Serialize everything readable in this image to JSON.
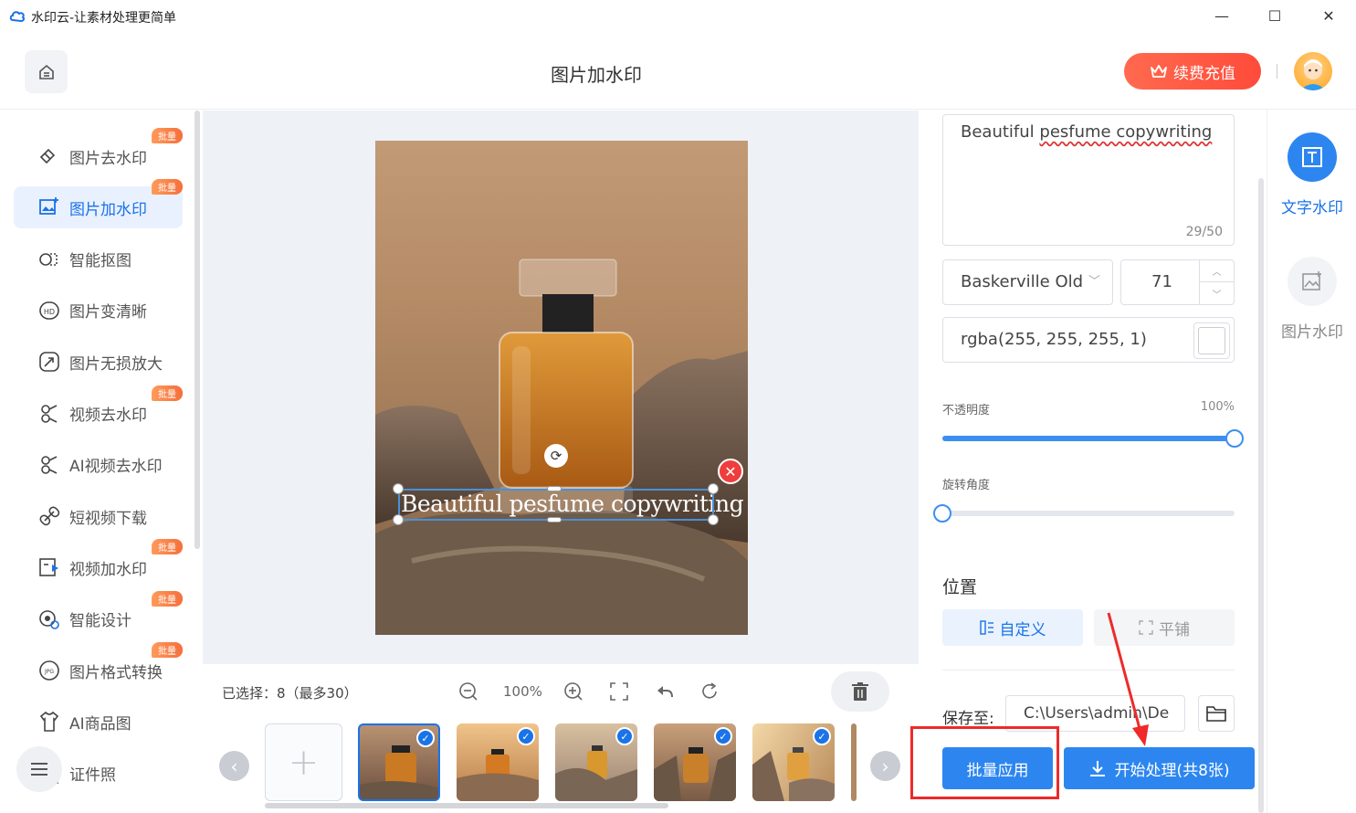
{
  "window": {
    "title": "水印云-让素材处理更简单",
    "minimize": "—",
    "maximize": "☐",
    "close": "✕"
  },
  "header": {
    "page_title": "图片加水印",
    "vip_label": "续费充值"
  },
  "sidebar": {
    "items": [
      {
        "label": "图片去水印",
        "badge": "批量",
        "icon": "eraser-icon"
      },
      {
        "label": "图片加水印",
        "badge": "批量",
        "icon": "image-watermark-icon",
        "active": true
      },
      {
        "label": "智能抠图",
        "badge": "",
        "icon": "cutout-icon"
      },
      {
        "label": "图片变清晰",
        "badge": "",
        "icon": "hd-icon"
      },
      {
        "label": "图片无损放大",
        "badge": "",
        "icon": "enlarge-icon"
      },
      {
        "label": "视频去水印",
        "badge": "批量",
        "icon": "video-eraser-icon"
      },
      {
        "label": "AI视频去水印",
        "badge": "",
        "icon": "ai-video-icon"
      },
      {
        "label": "短视频下载",
        "badge": "",
        "icon": "link-icon"
      },
      {
        "label": "视频加水印",
        "badge": "批量",
        "icon": "video-watermark-icon"
      },
      {
        "label": "智能设计",
        "badge": "批量",
        "icon": "design-icon"
      },
      {
        "label": "图片格式转换",
        "badge": "批量",
        "icon": "jpg-icon"
      },
      {
        "label": "AI商品图",
        "badge": "",
        "icon": "tshirt-icon"
      },
      {
        "label": "证件照",
        "badge": "",
        "icon": "id-photo-icon"
      }
    ]
  },
  "canvas": {
    "watermark_text": "Beautiful pesfume copywriting"
  },
  "toolbar": {
    "selected": "已选择：8（最多30）",
    "zoom": "100%"
  },
  "panel": {
    "text_value_a": "Beautiful ",
    "text_value_b": "pesfume copywriting",
    "char_count": "29/50",
    "font": "Baskerville Old",
    "size": "71",
    "color": "rgba(255, 255, 255, 1)",
    "opacity_label": "不透明度",
    "opacity_value": "100%",
    "opacity": 1.0,
    "rotation_label": "旋转角度",
    "rotation": 0.0,
    "position_title": "位置",
    "custom_label": "自定义",
    "tile_label": "平铺",
    "save_label": "保存至:",
    "save_path": "C:\\Users\\admin\\De",
    "batch_apply": "批量应用",
    "start_process": "开始处理(共8张)"
  },
  "right_rail": {
    "text_watermark": "文字水印",
    "image_watermark": "图片水印"
  },
  "colors": {
    "accent": "#2d86f0",
    "vip": "#ff5a42",
    "annotation": "#ee2a2a"
  }
}
